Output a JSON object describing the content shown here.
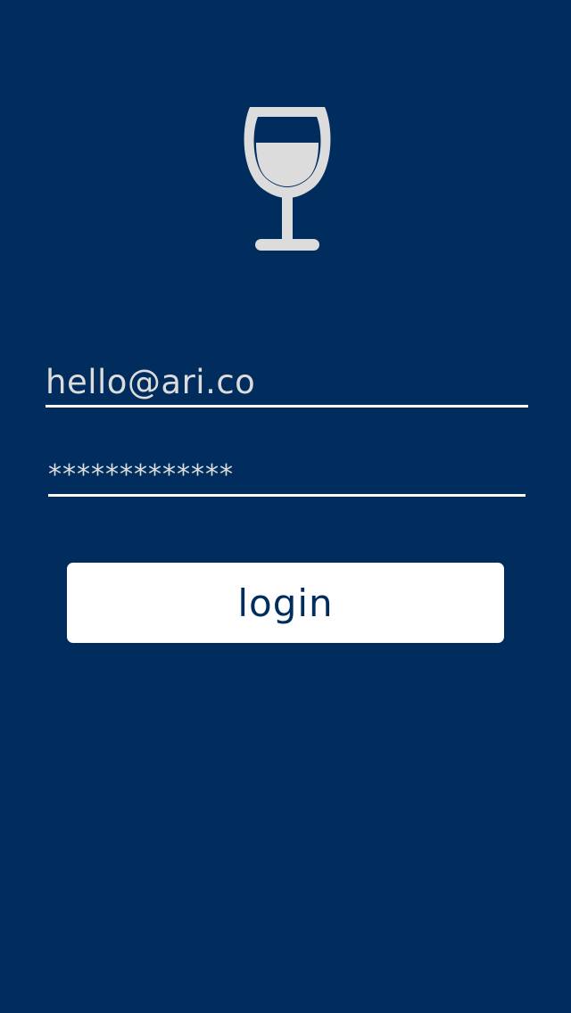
{
  "app": {
    "logo_icon": "wine-glass-icon",
    "background_color": "#002d5e",
    "accent_color": "#dcdcdc"
  },
  "login_form": {
    "email_value": "hello@ari.co",
    "password_value": "*************",
    "submit_label": "login"
  }
}
